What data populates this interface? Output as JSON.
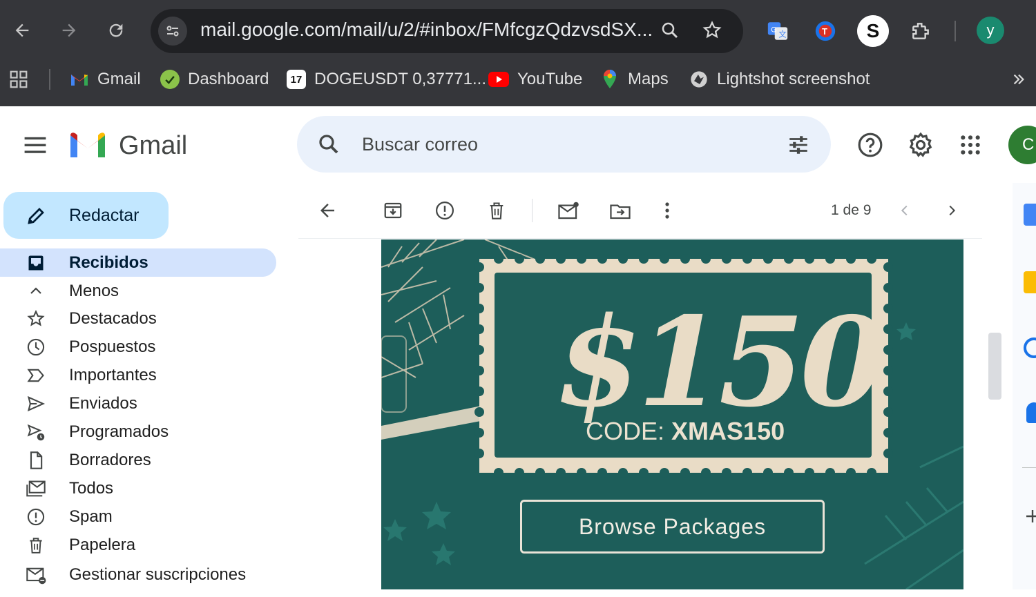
{
  "browser": {
    "url": "mail.google.com/mail/u/2/#inbox/FMfcgzQdzvsdSX...",
    "profile_initial": "y",
    "bookmarks": [
      {
        "label": "Gmail",
        "icon": "gmail-icon"
      },
      {
        "label": "Dashboard",
        "icon": "dashboard-icon"
      },
      {
        "label": "DOGEUSDT 0,37771...",
        "icon": "tradingview-icon"
      },
      {
        "label": "YouTube",
        "icon": "youtube-icon"
      },
      {
        "label": "Maps",
        "icon": "maps-icon"
      },
      {
        "label": "Lightshot screenshot",
        "icon": "lightshot-icon"
      }
    ]
  },
  "gmail": {
    "logo_text": "Gmail",
    "search_placeholder": "Buscar correo",
    "account_initial": "C",
    "compose_label": "Redactar",
    "nav": [
      {
        "label": "Recibidos",
        "icon": "inbox-icon",
        "active": true
      },
      {
        "label": "Menos",
        "icon": "chevron-up-icon"
      },
      {
        "label": "Destacados",
        "icon": "star-icon"
      },
      {
        "label": "Pospuestos",
        "icon": "clock-icon"
      },
      {
        "label": "Importantes",
        "icon": "important-icon"
      },
      {
        "label": "Enviados",
        "icon": "send-icon"
      },
      {
        "label": "Programados",
        "icon": "scheduled-icon"
      },
      {
        "label": "Borradores",
        "icon": "draft-icon"
      },
      {
        "label": "Todos",
        "icon": "all-mail-icon"
      },
      {
        "label": "Spam",
        "icon": "spam-icon"
      },
      {
        "label": "Papelera",
        "icon": "trash-icon"
      },
      {
        "label": "Gestionar suscripciones",
        "icon": "subscriptions-icon"
      }
    ],
    "message_counter": "1 de 9"
  },
  "email": {
    "price": "$150",
    "code_label": "CODE:",
    "code_value": "XMAS150",
    "cta_label": "Browse Packages"
  },
  "colors": {
    "chrome_bar": "#35363a",
    "compose_bg": "#c2e7ff",
    "active_nav_bg": "#d3e3fd",
    "email_bg": "#1d5e5a",
    "accent_green": "#2e7d32"
  }
}
